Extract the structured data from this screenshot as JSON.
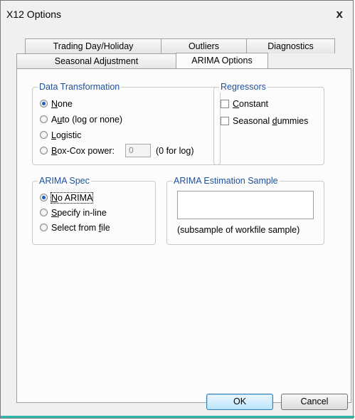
{
  "window": {
    "title": "X12 Options",
    "close_glyph": "x"
  },
  "tabs": {
    "row1": [
      "Trading Day/Holiday",
      "Outliers",
      "Diagnostics"
    ],
    "row2": [
      "Seasonal Adjustment",
      "ARIMA Options"
    ],
    "active": "ARIMA Options"
  },
  "data_transformation": {
    "title": "Data Transformation",
    "options": [
      {
        "pre": "",
        "u": "N",
        "post": "one",
        "checked": true
      },
      {
        "pre": "A",
        "u": "u",
        "post": "to (log or none)",
        "checked": false
      },
      {
        "pre": "",
        "u": "L",
        "post": "ogistic",
        "checked": false
      },
      {
        "pre": "",
        "u": "B",
        "post": "ox-Cox power:",
        "checked": false
      }
    ],
    "boxcox_value": "0",
    "boxcox_hint": "(0 for log)"
  },
  "regressors": {
    "title": "Regressors",
    "items": [
      {
        "pre": "",
        "u": "C",
        "post": "onstant",
        "checked": false
      },
      {
        "pre": "Seasonal ",
        "u": "d",
        "post": "ummies",
        "checked": false
      }
    ]
  },
  "arima_spec": {
    "title": "ARIMA Spec",
    "options": [
      {
        "pre": "",
        "u": "N",
        "post": "o ARIMA",
        "checked": true
      },
      {
        "pre": "",
        "u": "S",
        "post": "pecify in-line",
        "checked": false
      },
      {
        "pre": "Select from ",
        "u": "f",
        "post": "ile",
        "checked": false
      }
    ]
  },
  "estimation_sample": {
    "title": "ARIMA Estimation Sample",
    "value": "",
    "note": "(subsample of workfile sample)"
  },
  "buttons": {
    "ok": "OK",
    "cancel": "Cancel"
  },
  "colors": {
    "group_title": "#1e4f9c",
    "accent_strip": "#2fb8ab"
  }
}
